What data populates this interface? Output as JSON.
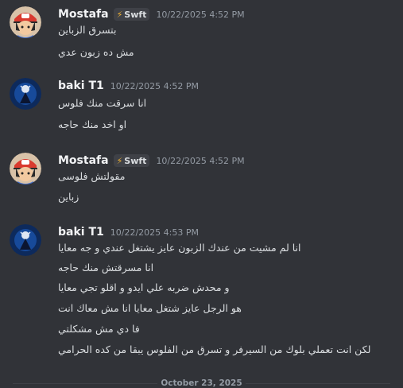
{
  "messages": [
    {
      "username": "Mostafa",
      "tag": "Swft",
      "timestamp": "10/22/2025 4:52 PM",
      "lines": [
        "بتسرق الزباين",
        "مش ده زبون عدي"
      ]
    },
    {
      "username": "baki T1",
      "timestamp": "10/22/2025 4:52 PM",
      "lines": [
        "انا سرقت منك فلوس",
        "او اخد منك حاجه"
      ]
    },
    {
      "username": "Mostafa",
      "tag": "Swft",
      "timestamp": "10/22/2025 4:52 PM",
      "lines": [
        "مقولتش فلوسى",
        "زباين"
      ]
    },
    {
      "username": "baki T1",
      "timestamp": "10/22/2025 4:53 PM",
      "lines": [
        "انا لم مشيت من عندك الزبون عايز يشتغل عندي و جه معايا",
        "انا مسرقتش منك حاجه",
        "و محدش ضربه علي ايدو و اقلو تجي معايا",
        "هو الرجل عايز شتغل معايا انا مش معاك انت",
        "فا دي مش مشكلتي",
        "لكن انت تعملي بلوك من السيرفر و تسرق من الفلوس يبقا من كده الحرامي"
      ]
    }
  ],
  "date_divider": "October 23, 2025",
  "colors": {
    "background": "#313338",
    "username": "#f2f3f5",
    "timestamp": "#949ba4",
    "tag_bolt": "#f0b132"
  }
}
